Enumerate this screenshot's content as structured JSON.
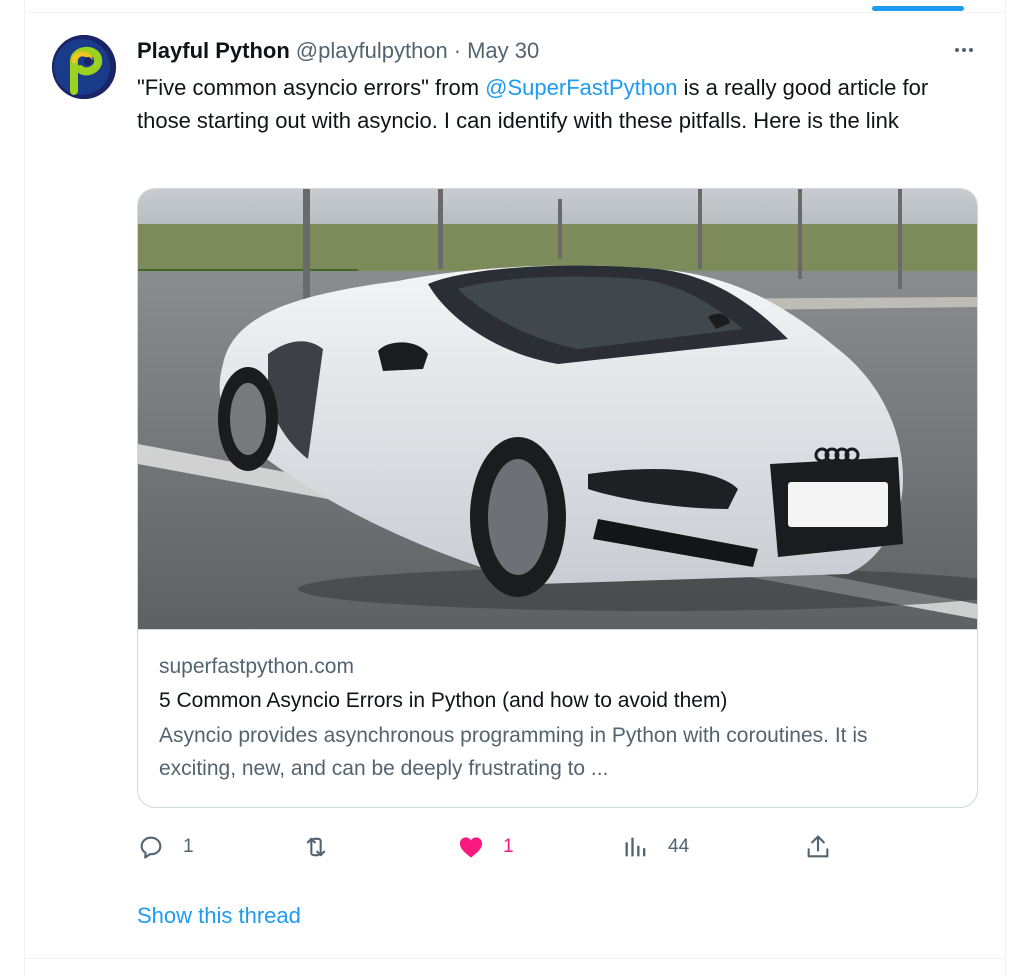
{
  "tweet": {
    "author_name": "Playful Python",
    "handle": "@playfulpython",
    "separator": "·",
    "date": "May 30",
    "text_prefix": "\"Five common asyncio errors\" from ",
    "mention": "@SuperFastPython",
    "text_suffix": " is a really good article for those starting out with asyncio. I can identify with these pitfalls. Here is the link",
    "more_icon": "more-horizontal-icon"
  },
  "card": {
    "image_icon": "car-photo",
    "domain": "superfastpython.com",
    "title": "5 Common Asyncio Errors in Python (and how to avoid them)",
    "description": "Asyncio provides asynchronous programming in Python with coroutines. It is exciting, new, and can be deeply frustrating to ..."
  },
  "actions": {
    "replies": "1",
    "retweets": "",
    "likes": "1",
    "views": "44",
    "like_color": "#f91880",
    "accent_color": "#1d9bf0"
  },
  "thread_link": "Show this thread"
}
